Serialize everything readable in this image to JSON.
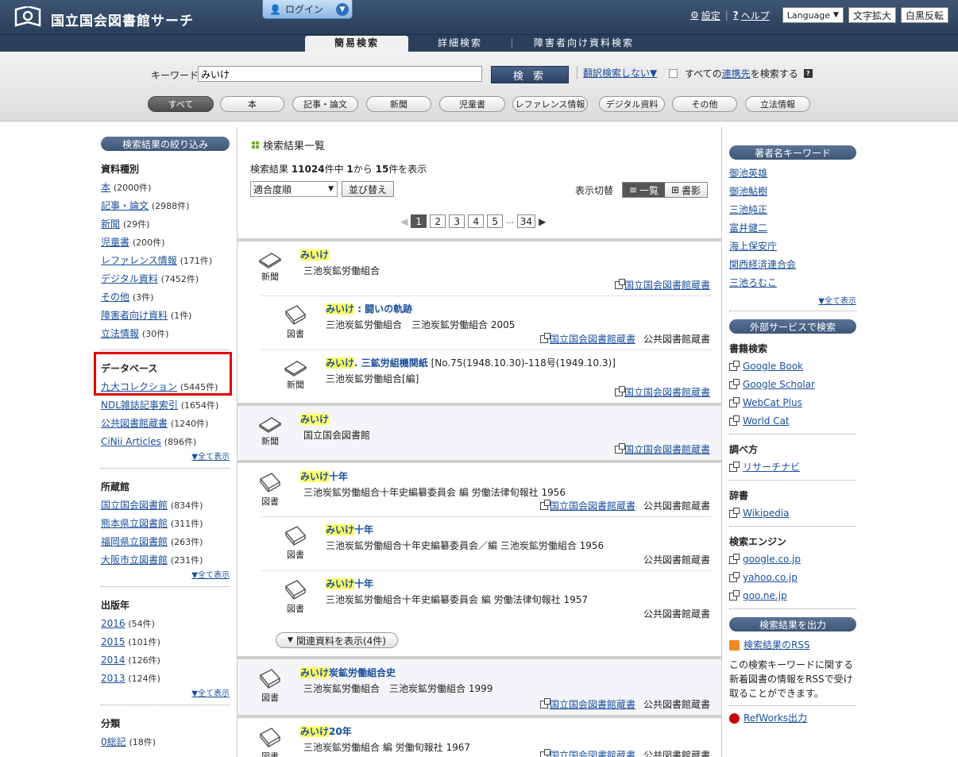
{
  "header": {
    "site_title": "国立国会図書館サーチ",
    "login_label": "ログイン",
    "settings_label": "設定",
    "help_label": "ヘルプ",
    "language_label": "Language",
    "text_enlarge_label": "文字拡大",
    "invert_label": "白黒反転"
  },
  "tabs": [
    "簡易検索",
    "詳細検索",
    "障害者向け資料検索"
  ],
  "search": {
    "keyword_label": "キーワード",
    "keyword_value": "みいけ",
    "search_button": "検 索",
    "translate_label": "翻訳検索しない▼",
    "all_sources_pre": "すべての",
    "all_sources_link": "連携先",
    "all_sources_post": "を検索する",
    "categories": [
      "すべて",
      "本",
      "記事・論文",
      "新聞",
      "児童書",
      "レファレンス情報",
      "デジタル資料",
      "その他",
      "立法情報"
    ]
  },
  "left": {
    "header": "検索結果の絞り込み",
    "material_type": {
      "title": "資料種別",
      "items": [
        {
          "label": "本",
          "count": "(2000件)"
        },
        {
          "label": "記事・論文",
          "count": "(2988件)"
        },
        {
          "label": "新聞",
          "count": "(29件)"
        },
        {
          "label": "児童書",
          "count": "(200件)"
        },
        {
          "label": "レファレンス情報",
          "count": "(171件)"
        },
        {
          "label": "デジタル資料",
          "count": "(7452件)"
        },
        {
          "label": "その他",
          "count": "(3件)"
        },
        {
          "label": "障害者向け資料",
          "count": "(1件)"
        },
        {
          "label": "立法情報",
          "count": "(30件)"
        }
      ]
    },
    "database": {
      "title": "データベース",
      "items": [
        {
          "label": "九大コレクション",
          "count": "(5445件)"
        },
        {
          "label": "NDL雑誌記事索引",
          "count": "(1654件)"
        },
        {
          "label": "公共図書館蔵書",
          "count": "(1240件)"
        },
        {
          "label": "CiNii Articles",
          "count": "(896件)"
        }
      ],
      "more": "▼全て表示"
    },
    "holdings": {
      "title": "所蔵館",
      "items": [
        {
          "label": "国立国会図書館",
          "count": "(834件)"
        },
        {
          "label": "熊本県立図書館",
          "count": "(311件)"
        },
        {
          "label": "福岡県立図書館",
          "count": "(263件)"
        },
        {
          "label": "大阪市立図書館",
          "count": "(231件)"
        }
      ],
      "more": "▼全て表示"
    },
    "year": {
      "title": "出版年",
      "items": [
        {
          "label": "2016",
          "count": "(54件)"
        },
        {
          "label": "2015",
          "count": "(101件)"
        },
        {
          "label": "2014",
          "count": "(126件)"
        },
        {
          "label": "2013",
          "count": "(124件)"
        }
      ],
      "more": "▼全て表示"
    },
    "classification": {
      "title": "分類",
      "items": [
        {
          "label": "0総記",
          "count": "(18件)"
        }
      ]
    }
  },
  "results": {
    "heading": "検索結果一覧",
    "summary_pre": "検索結果 ",
    "total": "11024",
    "summary_mid": "件中 ",
    "from": "1",
    "summary_mid2": "から ",
    "to": "15",
    "summary_post": "件を表示",
    "sort_value": "適合度順",
    "sort_button": "並び替え",
    "view_label": "表示切替",
    "view_list": "一覧",
    "view_cover": "書影",
    "pages": [
      "1",
      "2",
      "3",
      "4",
      "5",
      "...",
      "34"
    ],
    "items": [
      {
        "type": "新聞",
        "hl": "みいけ",
        "title_rest": "",
        "author": "三池炭鉱労働組合",
        "holdings": [
          "国立国会図書館蔵書"
        ],
        "plain_holdings": ""
      },
      {
        "type": "図書",
        "hl": "みいけ",
        "title_rest": " : 闘いの軌跡",
        "author": "三池炭鉱労働組合　三池炭鉱労働組合 2005",
        "holdings": [
          "国立国会図書館蔵書"
        ],
        "plain_holdings": "公共図書館蔵書"
      },
      {
        "type": "新聞",
        "hl": "みいけ",
        "title_rest": ". 三鉱労組機関紙",
        "title_plain": " [No.75(1948.10.30)-118号(1949.10.3)]",
        "author": "三池炭鉱労働組合[編]",
        "holdings": [
          "国立国会図書館蔵書"
        ],
        "plain_holdings": ""
      },
      {
        "type": "新聞",
        "hl": "みいけ",
        "title_rest": "",
        "author": "国立国会図書館",
        "holdings": [
          "国立国会図書館蔵書"
        ],
        "plain_holdings": ""
      },
      {
        "type": "図書",
        "hl": "みいけ",
        "title_rest": "十年",
        "author": "三池炭鉱労働組合十年史編纂委員会 編  労働法律旬報社 1956",
        "holdings": [
          "国立国会図書館蔵書"
        ],
        "plain_holdings": "公共図書館蔵書"
      },
      {
        "type": "図書",
        "hl": "みいけ",
        "title_rest": "十年",
        "author": "三池炭鉱労働組合十年史編纂委員会／編  三池炭鉱労働組合 1956",
        "holdings": [],
        "plain_holdings": "公共図書館蔵書"
      },
      {
        "type": "図書",
        "hl": "みいけ",
        "title_rest": "十年",
        "author": "三池炭鉱労働組合十年史編纂委員会 編  労働法律旬報社 1957",
        "holdings": [],
        "plain_holdings": "公共図書館蔵書"
      },
      {
        "type": "図書",
        "hl": "みいけ",
        "title_rest": "炭鉱労働組合史",
        "author": "三池炭鉱労働組合　三池炭鉱労働組合 1999",
        "holdings": [
          "国立国会図書館蔵書"
        ],
        "plain_holdings": "公共図書館蔵書"
      },
      {
        "type": "図書",
        "hl": "みいけ",
        "title_rest": "20年",
        "author": "三池炭鉱労働組合 編  労働旬報社 1967",
        "holdings": [
          "国立国会図書館蔵書"
        ],
        "plain_holdings": "公共図書館蔵書"
      }
    ],
    "related_button": "関連資料を表示(4件)"
  },
  "right": {
    "author_keywords": {
      "title": "著者名キーワード",
      "items": [
        "御池英雄",
        "御池鮎樹",
        "三池純正",
        "富井健二",
        "海上保安庁",
        "関西経済連合会",
        "三池ろむこ"
      ],
      "more": "▼全て表示"
    },
    "external": {
      "title": "外部サービスで検索",
      "book_search": "書籍検索",
      "book_items": [
        "Google Book",
        "Google Scholar",
        "WebCat Plus",
        "World Cat"
      ],
      "research": "調べ方",
      "research_items": [
        "リサーチナビ"
      ],
      "dictionary": "辞書",
      "dictionary_items": [
        "Wikipedia"
      ],
      "engine": "検索エンジン",
      "engine_items": [
        "google.co.jp",
        "yahoo.co.jp",
        "goo.ne.jp"
      ]
    },
    "output": {
      "title": "検索結果を出力",
      "rss_label": "検索結果のRSS",
      "rss_desc": "この検索キーワードに関する新着図書の情報をRSSで受け取ることができます。",
      "refworks_label": "RefWorks出力"
    }
  }
}
